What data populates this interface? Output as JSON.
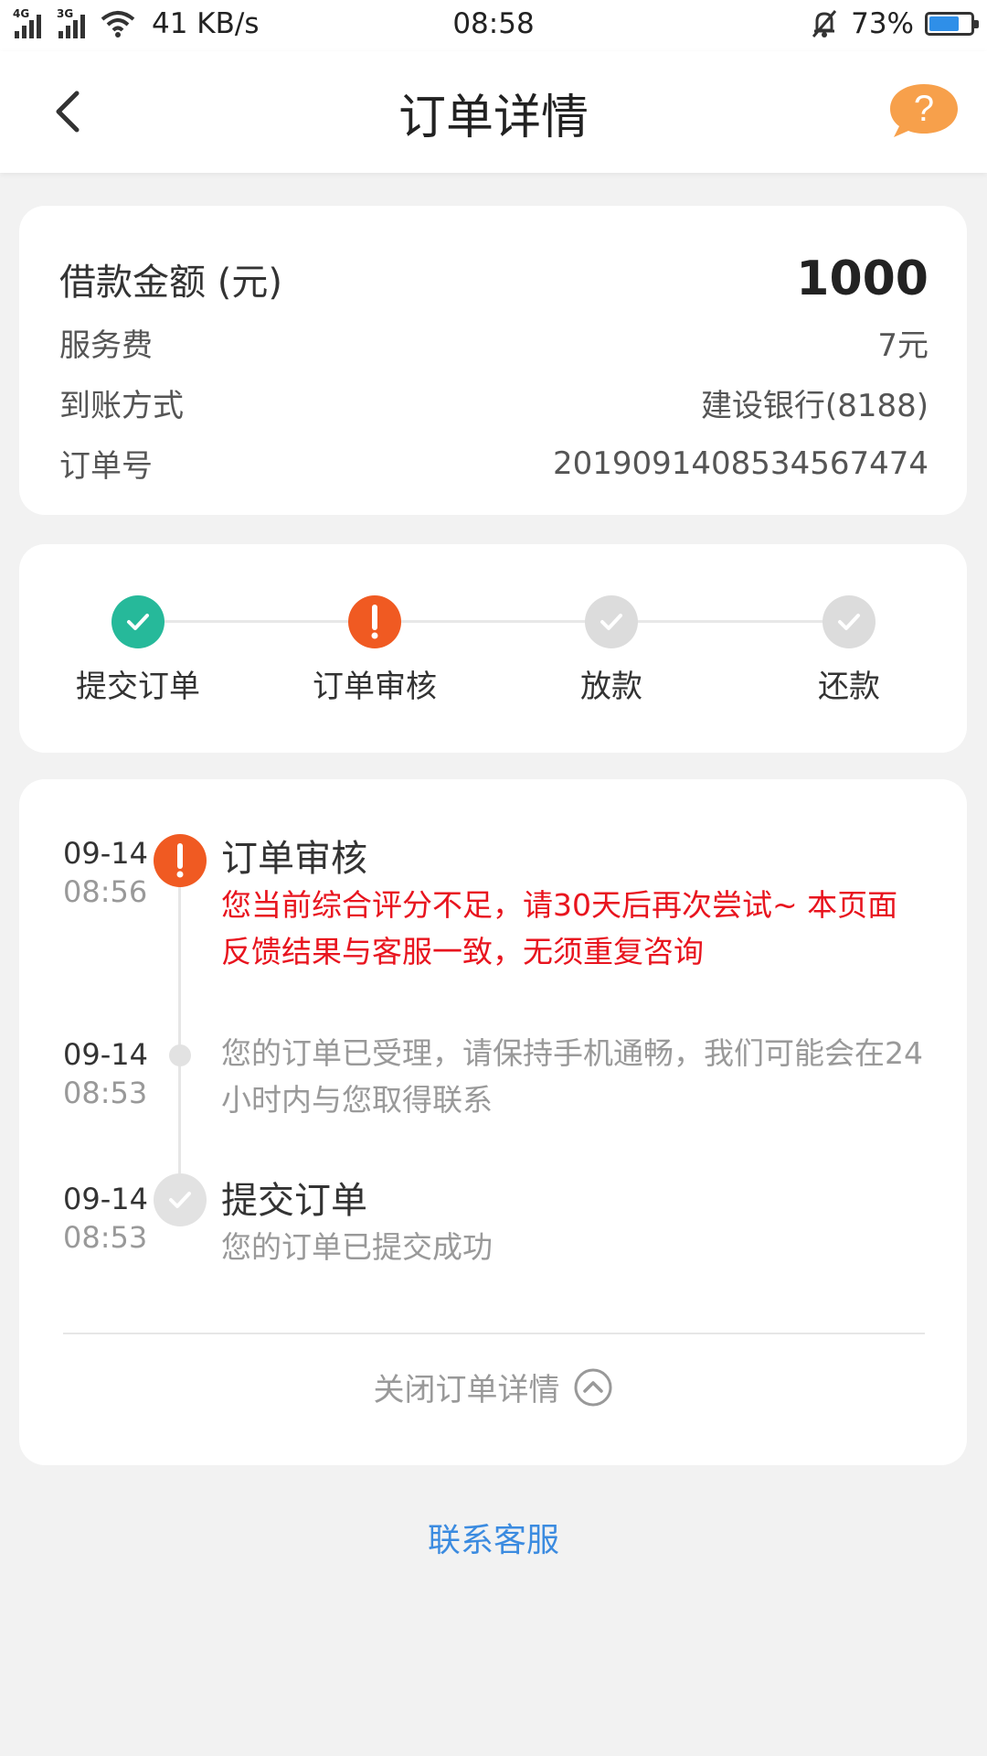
{
  "status_bar": {
    "network1": "4G",
    "network2": "3G",
    "speed": "41 KB/s",
    "time": "08:58",
    "battery": "73%",
    "battery_level": 0.73
  },
  "header": {
    "title": "订单详情",
    "help_icon": "question-bubble-icon"
  },
  "summary": {
    "amount_label": "借款金额 (元)",
    "amount_value": "1000",
    "fee_label": "服务费",
    "fee_value": "7元",
    "payout_label": "到账方式",
    "payout_value": "建设银行(8188)",
    "order_no_label": "订单号",
    "order_no_value": "201909140853456747 4"
  },
  "steps": [
    {
      "label": "提交订单",
      "state": "done"
    },
    {
      "label": "订单审核",
      "state": "warning"
    },
    {
      "label": "放款",
      "state": "pending"
    },
    {
      "label": "还款",
      "state": "pending"
    }
  ],
  "timeline": [
    {
      "date": "09-14",
      "time": "08:56",
      "title": "订单审核",
      "desc": "您当前综合评分不足，请30天后再次尝试~ 本页面反馈结果与客服一致，无须重复咨询",
      "state": "warning"
    },
    {
      "date": "09-14",
      "time": "08:53",
      "title": "",
      "desc": "您的订单已受理，请保持手机通畅，我们可能会在24小时内与您取得联系",
      "state": "info"
    },
    {
      "date": "09-14",
      "time": "08:53",
      "title": "提交订单",
      "desc": "您的订单已提交成功",
      "state": "done"
    }
  ],
  "collapse_label": "关闭订单详情",
  "contact_label": "联系客服",
  "colors": {
    "accent_orange": "#f05a22",
    "success_green": "#26b99a",
    "alert_red": "#e8141e",
    "link_blue": "#3b8be0"
  }
}
